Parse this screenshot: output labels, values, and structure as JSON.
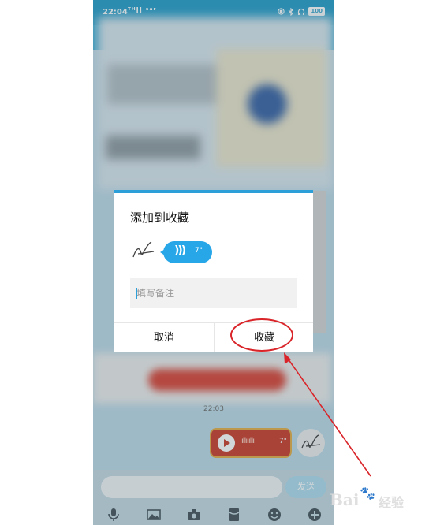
{
  "status_bar": {
    "time": "22:04",
    "signal": "ᵀᴴll ˢᵃʳ",
    "battery": "100",
    "icons": [
      "nfc-icon",
      "bluetooth-icon",
      "headset-icon",
      "battery-icon"
    ]
  },
  "chat": {
    "timestamp": "22:03",
    "voice_message": {
      "duration": "7\""
    },
    "input": {
      "send_label": "发送"
    },
    "toolbar_icons": [
      "microphone-icon",
      "image-icon",
      "camera-icon",
      "red-packet-icon",
      "emoji-icon",
      "plus-icon"
    ]
  },
  "dialog": {
    "title": "添加到收藏",
    "voice_duration": "7\"",
    "remark_placeholder": "填写备注",
    "cancel_label": "取消",
    "favorite_label": "收藏",
    "accent_color": "#2d9fd8"
  },
  "watermark": {
    "brand_text": "Bai",
    "brand_suffix": "经验",
    "paw_glyph": "🐾"
  },
  "annotation": {
    "color": "#d9252a"
  }
}
